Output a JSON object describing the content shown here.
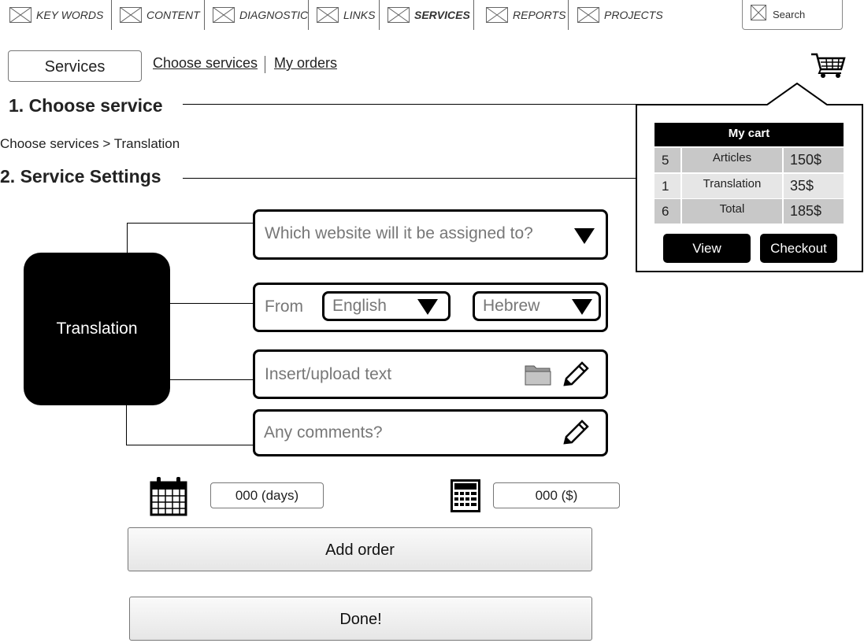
{
  "nav": {
    "items": [
      {
        "label": "KEY WORDS",
        "icon": "placeholder-image-icon"
      },
      {
        "label": "CONTENT",
        "icon": "placeholder-image-icon"
      },
      {
        "label": "DIAGNOSTIC",
        "icon": "placeholder-image-icon"
      },
      {
        "label": "LINKS",
        "icon": "placeholder-image-icon"
      },
      {
        "label": "SERVICES",
        "icon": "placeholder-image-icon",
        "active": true
      },
      {
        "label": "REPORTS",
        "icon": "placeholder-image-icon"
      },
      {
        "label": "PROJECTS",
        "icon": "placeholder-image-icon"
      }
    ],
    "search_label": "Search"
  },
  "subnav": {
    "services_button": "Services",
    "choose_services_link": "Choose services",
    "my_orders_link": "My orders"
  },
  "sections": {
    "choose_service_title": "1. Choose service",
    "breadcrumb": "Choose services > Translation",
    "settings_title": "2. Service Settings"
  },
  "service": {
    "name": "Translation",
    "website_placeholder": "Which website will it be assigned to?",
    "from_label": "From",
    "from_language": "English",
    "to_language": "Hebrew",
    "upload_placeholder": "Insert/upload  text",
    "comments_placeholder": "Any comments?",
    "days_value": "000 (days)",
    "price_value": "000 ($)",
    "add_order_label": "Add order",
    "done_label": "Done!"
  },
  "cart": {
    "title": "My cart",
    "rows": [
      {
        "qty": "5",
        "item": "Articles",
        "price": "150$"
      },
      {
        "qty": "1",
        "item": "Translation",
        "price": "35$"
      },
      {
        "qty": "6",
        "item": "Total",
        "price": "185$"
      }
    ],
    "view_label": "View",
    "checkout_label": "Checkout"
  },
  "colors": {
    "accent": "#000000",
    "row_dark": "#c8c8c8",
    "row_light": "#e6e6e6"
  }
}
